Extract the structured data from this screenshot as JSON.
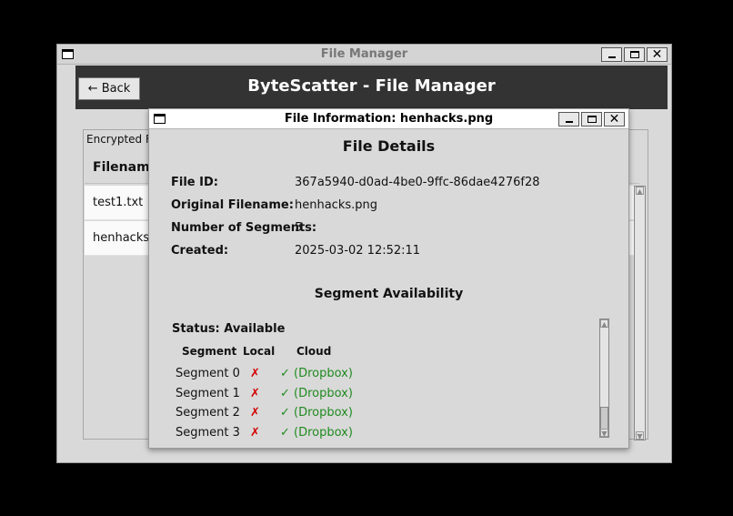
{
  "main_window": {
    "title": "File Manager",
    "header": {
      "back_label": "← Back",
      "title": "ByteScatter - File Manager"
    },
    "files_frame": {
      "label": "Encrypted Fi",
      "column_header": "Filename",
      "rows": [
        "test1.txt",
        "henhacks.p"
      ]
    }
  },
  "dialog": {
    "title": "File Information: henhacks.png",
    "heading": "File Details",
    "info": [
      {
        "label": "File ID:",
        "value": "367a5940-d0ad-4be0-9ffc-86dae4276f28"
      },
      {
        "label": "Original Filename:",
        "value": "henhacks.png"
      },
      {
        "label": "Number of Segments:",
        "value": "5"
      },
      {
        "label": "Created:",
        "value": "2025-03-02 12:52:11"
      }
    ],
    "segment_heading": "Segment Availability",
    "status": "Status: Available",
    "segment_columns": {
      "segment": "Segment",
      "local": "Local",
      "cloud": "Cloud"
    },
    "segments": [
      {
        "name": "Segment 0",
        "local": "✗",
        "cloud": "✓ (Dropbox)"
      },
      {
        "name": "Segment 1",
        "local": "✗",
        "cloud": "✓ (Dropbox)"
      },
      {
        "name": "Segment 2",
        "local": "✗",
        "cloud": "✓ (Dropbox)"
      },
      {
        "name": "Segment 3",
        "local": "✗",
        "cloud": "✓ (Dropbox)"
      }
    ]
  },
  "window_controls": {
    "minimize": "minimize-icon",
    "maximize": "maximize-icon",
    "close": "✕"
  },
  "colors": {
    "header_bg": "#333333",
    "missing": "#d40000",
    "available": "#1f8a1f"
  }
}
